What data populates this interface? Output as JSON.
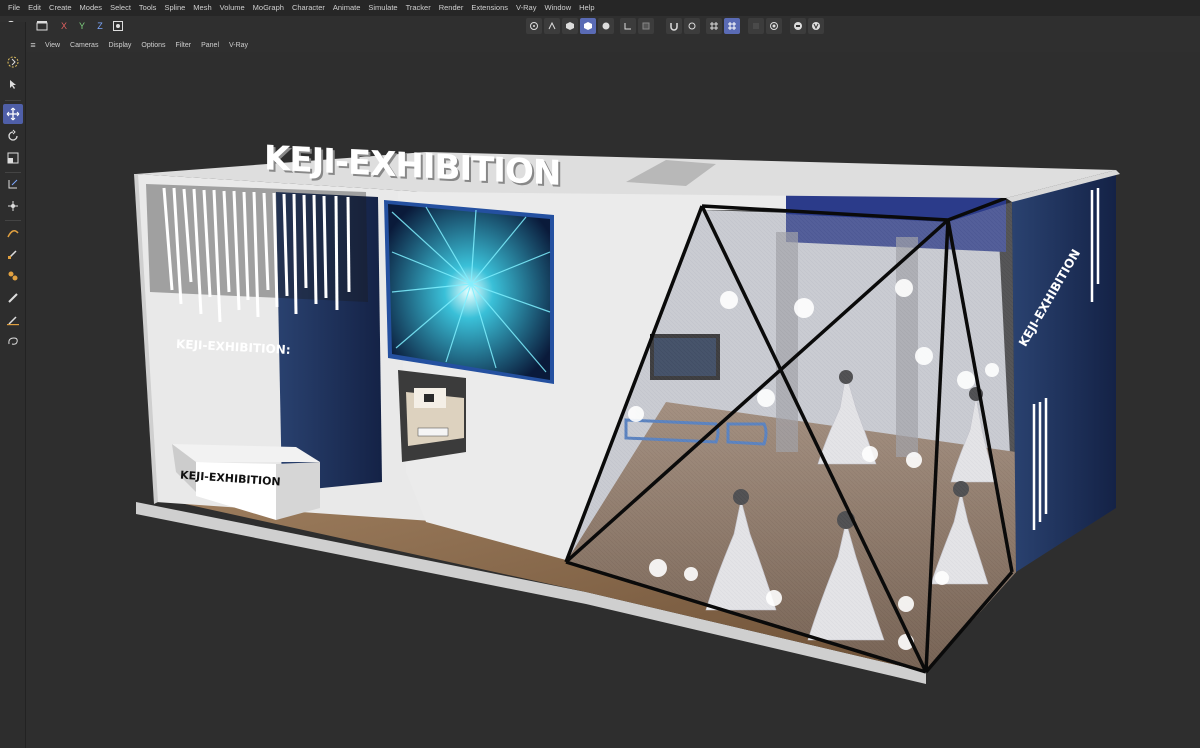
{
  "menubar": {
    "items": [
      "File",
      "Edit",
      "Create",
      "Modes",
      "Select",
      "Tools",
      "Spline",
      "Mesh",
      "Volume",
      "MoGraph",
      "Character",
      "Animate",
      "Simulate",
      "Tracker",
      "Render",
      "Extensions",
      "V-Ray",
      "Window",
      "Help"
    ]
  },
  "toolbar": {
    "axis_x": "X",
    "axis_y": "Y",
    "axis_z": "Z"
  },
  "viewport_menu": {
    "items": [
      "View",
      "Cameras",
      "Display",
      "Options",
      "Filter",
      "Panel",
      "V-Ray"
    ]
  },
  "scene": {
    "roof_sign": "KEJI-EXHIBITION",
    "wall_sign": "KEJI-EXHIBITION:",
    "counter_sign": "KEJI-EXHIBITION",
    "side_sign": "KEJI-EXHIBITION"
  },
  "colors": {
    "accent": "#5a6bb5",
    "viewport_bg": "#2e2e2e",
    "wall": "#e8e8e8",
    "floor": "#8a6a4a",
    "navy_panel": "#1d2d55"
  }
}
